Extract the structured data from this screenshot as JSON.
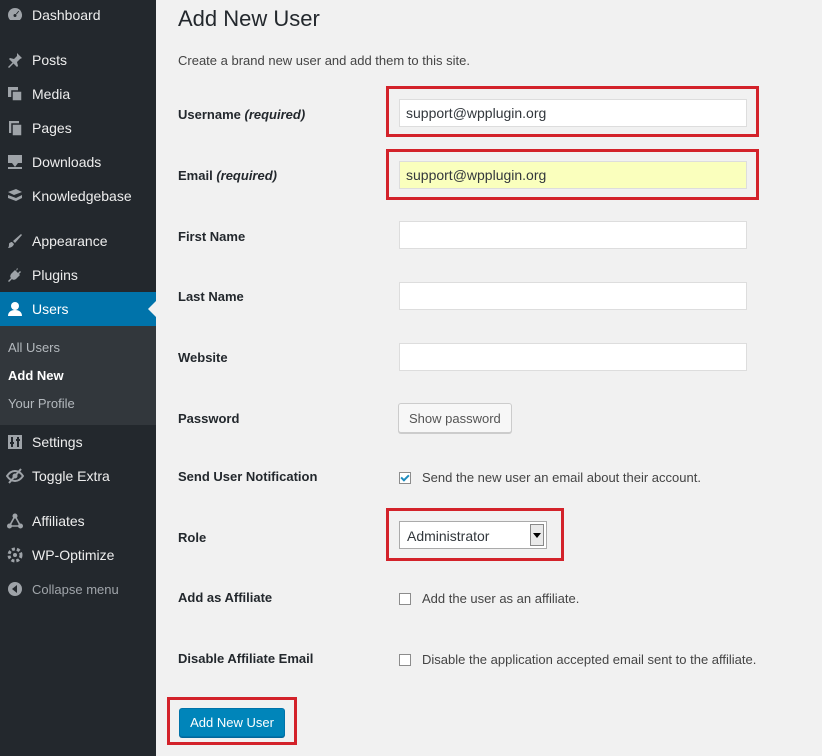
{
  "sidebar": {
    "items": [
      {
        "label": "Dashboard",
        "icon": "dashboard-icon"
      },
      {
        "label": "Posts",
        "icon": "pin-icon"
      },
      {
        "label": "Media",
        "icon": "media-icon"
      },
      {
        "label": "Pages",
        "icon": "pages-icon"
      },
      {
        "label": "Downloads",
        "icon": "download-icon"
      },
      {
        "label": "Knowledgebase",
        "icon": "book-icon"
      },
      {
        "label": "Appearance",
        "icon": "paintbrush-icon"
      },
      {
        "label": "Plugins",
        "icon": "plugin-icon"
      },
      {
        "label": "Users",
        "icon": "user-icon"
      },
      {
        "label": "Settings",
        "icon": "settings-icon"
      },
      {
        "label": "Toggle Extra",
        "icon": "eye-slash-icon"
      },
      {
        "label": "Affiliates",
        "icon": "share-icon"
      },
      {
        "label": "WP-Optimize",
        "icon": "gear-icon"
      },
      {
        "label": "Collapse menu",
        "icon": "collapse-icon"
      }
    ],
    "submenu": [
      "All Users",
      "Add New",
      "Your Profile"
    ],
    "active_color": "#0073aa"
  },
  "page": {
    "title": "Add New User",
    "subtitle": "Create a brand new user and add them to this site."
  },
  "form": {
    "username_label": "Username",
    "email_label": "Email",
    "required_text": "(required)",
    "username_value": "support@wpplugin.org",
    "email_value": "support@wpplugin.org",
    "first_name_label": "First Name",
    "first_name_value": "",
    "last_name_label": "Last Name",
    "last_name_value": "",
    "website_label": "Website",
    "website_value": "",
    "password_label": "Password",
    "show_password_label": "Show password",
    "notification_label": "Send User Notification",
    "notification_text": "Send the new user an email about their account.",
    "notification_checked": true,
    "role_label": "Role",
    "role_value": "Administrator",
    "affiliate_label": "Add as Affiliate",
    "affiliate_text": "Add the user as an affiliate.",
    "affiliate_checked": false,
    "disable_email_label": "Disable Affiliate Email",
    "disable_email_text": "Disable the application accepted email sent to the affiliate.",
    "disable_email_checked": false,
    "submit_label": "Add New User"
  },
  "colors": {
    "highlight": "#d3222a",
    "primary_button": "#0085ba",
    "autofill": "#faffbd"
  }
}
